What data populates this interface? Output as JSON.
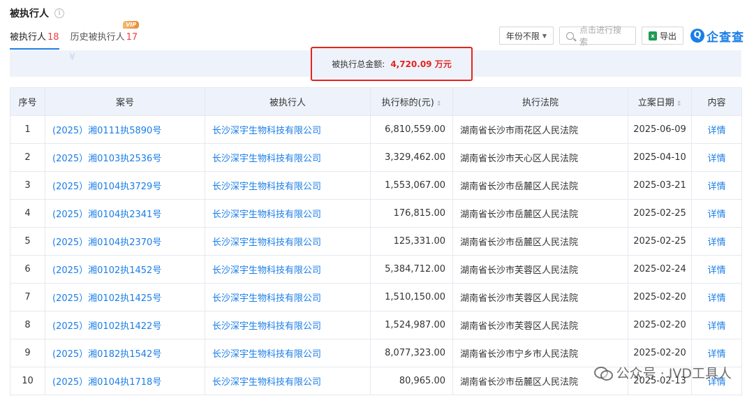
{
  "section": {
    "title": "被执行人"
  },
  "tabs": [
    {
      "label": "被执行人",
      "count": "18"
    },
    {
      "label": "历史被执行人",
      "count": "17",
      "badge": "VIP"
    }
  ],
  "toolbar": {
    "year_filter": "年份不限",
    "search_placeholder": "点击进行搜索",
    "export_label": "导出",
    "logo_text": "企查查"
  },
  "summary": {
    "label": "被执行总金额:",
    "amount": "4,720.09 万元"
  },
  "table": {
    "headers": [
      "序号",
      "案号",
      "被执行人",
      "执行标的(元)",
      "执行法院",
      "立案日期",
      "内容"
    ],
    "rows": [
      [
        "1",
        "(2025）湘0111执5890号",
        "长沙深宇生物科技有限公司",
        "6,810,559.00",
        "湖南省长沙市雨花区人民法院",
        "2025-06-09",
        "详情"
      ],
      [
        "2",
        "(2025）湘0103执2536号",
        "长沙深宇生物科技有限公司",
        "3,329,462.00",
        "湖南省长沙市天心区人民法院",
        "2025-04-10",
        "详情"
      ],
      [
        "3",
        "(2025）湘0104执3729号",
        "长沙深宇生物科技有限公司",
        "1,553,067.00",
        "湖南省长沙市岳麓区人民法院",
        "2025-03-21",
        "详情"
      ],
      [
        "4",
        "(2025）湘0104执2341号",
        "长沙深宇生物科技有限公司",
        "176,815.00",
        "湖南省长沙市岳麓区人民法院",
        "2025-02-25",
        "详情"
      ],
      [
        "5",
        "(2025）湘0104执2370号",
        "长沙深宇生物科技有限公司",
        "125,331.00",
        "湖南省长沙市岳麓区人民法院",
        "2025-02-25",
        "详情"
      ],
      [
        "6",
        "(2025）湘0102执1452号",
        "长沙深宇生物科技有限公司",
        "5,384,712.00",
        "湖南省长沙市芙蓉区人民法院",
        "2025-02-24",
        "详情"
      ],
      [
        "7",
        "(2025）湘0102执1425号",
        "长沙深宇生物科技有限公司",
        "1,510,150.00",
        "湖南省长沙市芙蓉区人民法院",
        "2025-02-20",
        "详情"
      ],
      [
        "8",
        "(2025）湘0102执1422号",
        "长沙深宇生物科技有限公司",
        "1,524,987.00",
        "湖南省长沙市芙蓉区人民法院",
        "2025-02-20",
        "详情"
      ],
      [
        "9",
        "(2025）湘0182执1542号",
        "长沙深宇生物科技有限公司",
        "8,077,323.00",
        "湖南省长沙市宁乡市人民法院",
        "2025-02-20",
        "详情"
      ],
      [
        "10",
        "(2025）湘0104执1718号",
        "长沙深宇生物科技有限公司",
        "80,965.00",
        "湖南省长沙市岳麓区人民法院",
        "2025-02-13",
        "详情"
      ]
    ]
  },
  "watermark": {
    "text": "公众号 · IVD工具人"
  },
  "colors": {
    "accent": "#1a7ee8",
    "highlight": "#e6231f",
    "header_bg": "#eef3fb"
  }
}
